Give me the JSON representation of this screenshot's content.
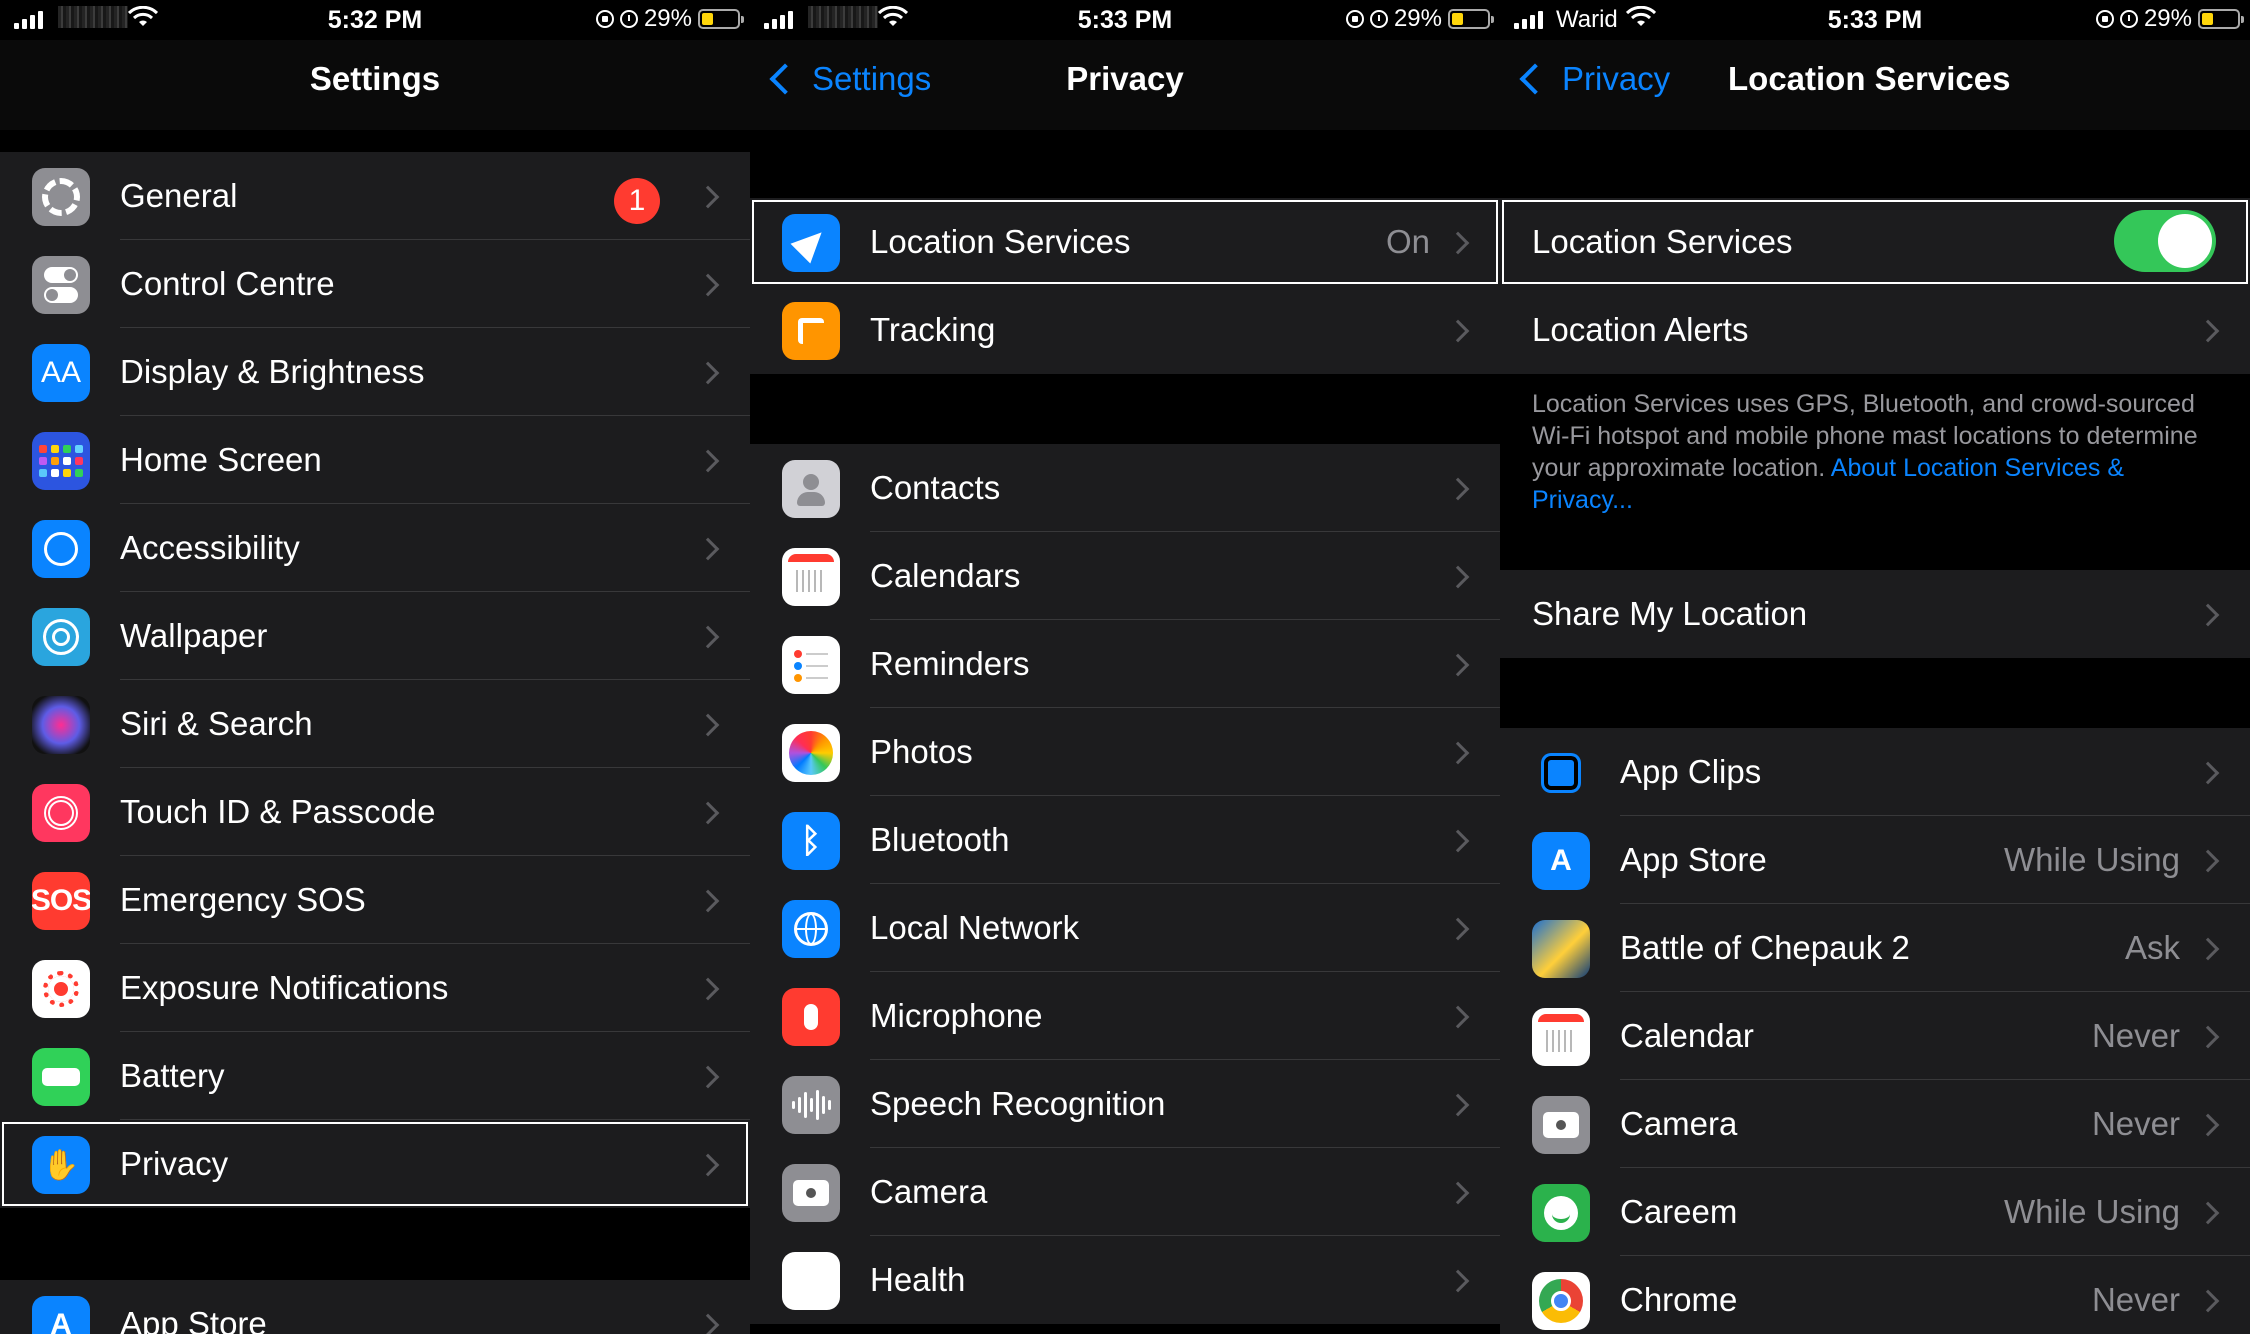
{
  "screens": [
    {
      "status": {
        "time": "5:32 PM",
        "carrier": "",
        "battery": "29%"
      },
      "nav": {
        "title": "Settings",
        "back": ""
      },
      "rows": [
        {
          "label": "General",
          "badge": "1"
        },
        {
          "label": "Control Centre"
        },
        {
          "label": "Display & Brightness",
          "icon_text": "AA"
        },
        {
          "label": "Home Screen"
        },
        {
          "label": "Accessibility"
        },
        {
          "label": "Wallpaper"
        },
        {
          "label": "Siri & Search"
        },
        {
          "label": "Touch ID & Passcode"
        },
        {
          "label": "Emergency SOS",
          "icon_text": "SOS"
        },
        {
          "label": "Exposure Notifications"
        },
        {
          "label": "Battery"
        },
        {
          "label": "Privacy"
        },
        {
          "label": "App Store"
        }
      ]
    },
    {
      "status": {
        "time": "5:33 PM",
        "carrier": "",
        "battery": "29%"
      },
      "nav": {
        "title": "Privacy",
        "back": "Settings"
      },
      "rows": [
        {
          "label": "Location Services",
          "value": "On"
        },
        {
          "label": "Tracking"
        },
        {
          "label": "Contacts"
        },
        {
          "label": "Calendars"
        },
        {
          "label": "Reminders"
        },
        {
          "label": "Photos"
        },
        {
          "label": "Bluetooth"
        },
        {
          "label": "Local Network"
        },
        {
          "label": "Microphone"
        },
        {
          "label": "Speech Recognition"
        },
        {
          "label": "Camera"
        },
        {
          "label": "Health"
        }
      ]
    },
    {
      "status": {
        "time": "5:33 PM",
        "carrier": "Warid",
        "battery": "29%"
      },
      "nav": {
        "title": "Location Services",
        "back": "Privacy"
      },
      "top_rows": [
        {
          "label": "Location Services",
          "toggle": "on"
        },
        {
          "label": "Location Alerts"
        }
      ],
      "footnote": {
        "text": "Location Services uses GPS, Bluetooth, and crowd-sourced Wi-Fi hotspot and mobile phone mast locations to determine your approximate location.",
        "link": "About Location Services & Privacy..."
      },
      "share_row": {
        "label": "Share My Location"
      },
      "apps": [
        {
          "label": "App Clips",
          "value": ""
        },
        {
          "label": "App Store",
          "value": "While Using"
        },
        {
          "label": "Battle of Chepauk 2",
          "value": "Ask"
        },
        {
          "label": "Calendar",
          "value": "Never"
        },
        {
          "label": "Camera",
          "value": "Never"
        },
        {
          "label": "Careem",
          "value": "While Using"
        },
        {
          "label": "Chrome",
          "value": "Never"
        }
      ]
    }
  ],
  "colors": {
    "accent": "#0a84ff",
    "toggle_on": "#34c759",
    "badge": "#ff3b30",
    "battery_level": "#ffd60a",
    "cell_bg": "#1c1c1e",
    "secondary_text": "#8e8e93"
  },
  "icons": {
    "settings": [
      "gear-icon",
      "control-centre-icon",
      "display-icon",
      "home-screen-icon",
      "accessibility-icon",
      "wallpaper-icon",
      "siri-icon",
      "fingerprint-icon",
      "sos-icon",
      "exposure-icon",
      "battery-icon",
      "hand-icon",
      "app-store-icon"
    ],
    "privacy": [
      "location-arrow-icon",
      "tracking-icon",
      "contacts-icon",
      "calendars-icon",
      "reminders-icon",
      "photos-icon",
      "bluetooth-icon",
      "local-network-icon",
      "microphone-icon",
      "speech-recognition-icon",
      "camera-icon",
      "health-icon"
    ],
    "location_apps": [
      "app-clips-icon",
      "app-store-icon",
      "battle-of-chepauk-icon",
      "calendar-icon",
      "camera-icon",
      "careem-icon",
      "chrome-icon"
    ]
  }
}
